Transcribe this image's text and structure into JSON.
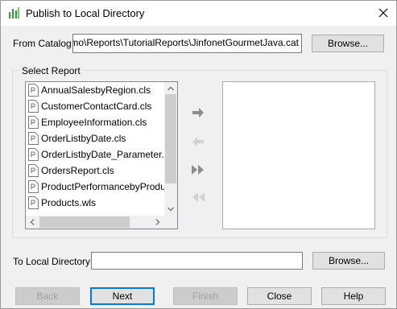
{
  "window": {
    "title": "Publish to Local Directory"
  },
  "catalog": {
    "label": "From Catalog:",
    "value": "Demo\\Reports\\TutorialReports\\JinfonetGourmetJava.cat",
    "browse_label": "Browse..."
  },
  "select_report": {
    "group_label": "Select Report",
    "items": [
      {
        "label": "AnnualSalesbyRegion.cls"
      },
      {
        "label": "CustomerContactCard.cls"
      },
      {
        "label": "EmployeeInformation.cls"
      },
      {
        "label": "OrderListbyDate.cls"
      },
      {
        "label": "OrderListbyDate_Parameter.cls"
      },
      {
        "label": "OrdersReport.cls"
      },
      {
        "label": "ProductPerformancebyProductName.cls"
      },
      {
        "label": "Products.wls"
      }
    ]
  },
  "local_directory": {
    "label": "To Local Directory:",
    "value": "",
    "browse_label": "Browse..."
  },
  "footer": {
    "back_label": "Back",
    "next_label": "Next",
    "finish_label": "Finish",
    "close_label": "Close",
    "help_label": "Help"
  },
  "icons": {
    "app": "report-app-icon",
    "close": "close-icon",
    "file": "report-file-icon",
    "add": "arrow-right-icon",
    "remove": "arrow-left-icon",
    "add_all": "double-arrow-right-icon",
    "remove_all": "double-arrow-left-icon"
  },
  "colors": {
    "accent": "#0078d7",
    "app_icon": "#2e9e3e"
  }
}
